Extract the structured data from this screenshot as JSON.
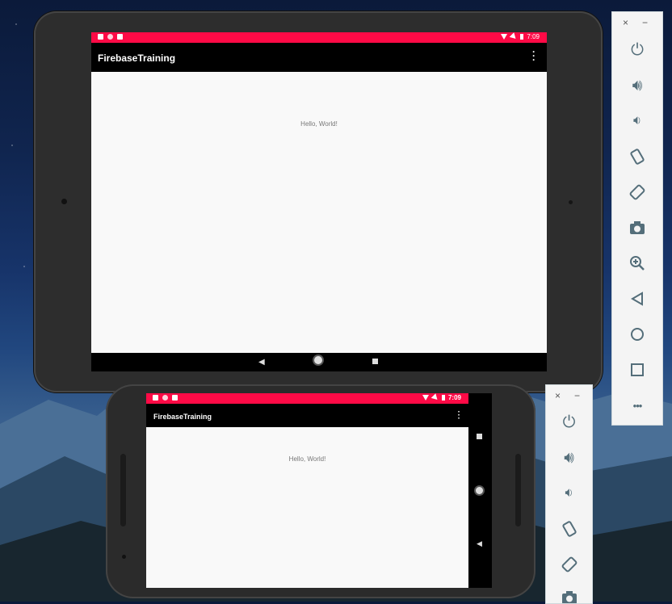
{
  "tablet": {
    "status_time": "7:09",
    "app_title": "FirebaseTraining",
    "hello_text": "Hello, World!"
  },
  "phone": {
    "status_time": "7:09",
    "app_title": "FirebaseTraining",
    "hello_text": "Hello, World!"
  },
  "toolbar_large": {
    "close": "×",
    "minimize": "−",
    "more": "•••"
  },
  "toolbar_small": {
    "close": "×",
    "minimize": "−"
  },
  "colors": {
    "status_bar": "#ff0a46",
    "app_bar": "#000000",
    "content_bg": "#f9f9f9",
    "toolbar_icon": "#546e7a"
  }
}
